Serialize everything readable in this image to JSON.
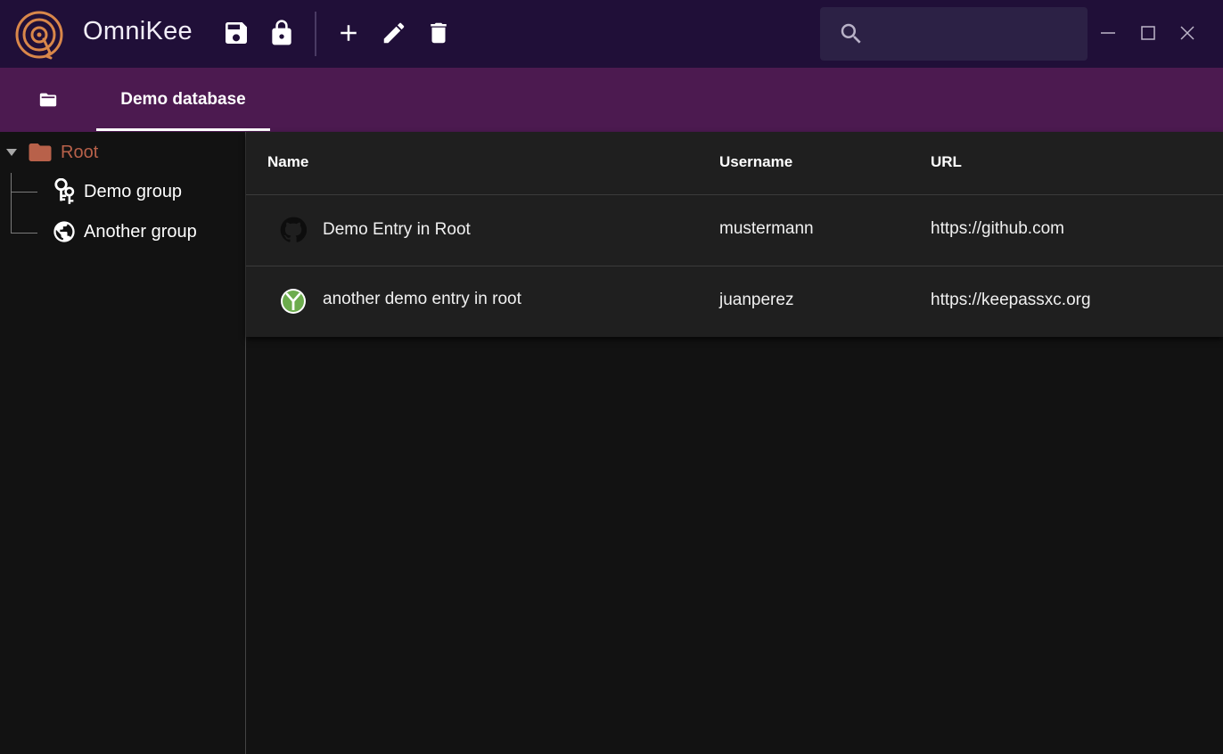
{
  "app": {
    "title": "OmniKee",
    "logo_icon": "omnikee-logo-icon",
    "accent_color": "#d9874a"
  },
  "toolbar": {
    "icons": [
      "save-icon",
      "lock-icon",
      "add-icon",
      "edit-icon",
      "delete-icon"
    ]
  },
  "search": {
    "value": "",
    "placeholder": "",
    "icon": "search-icon"
  },
  "window_controls": [
    "minimize-icon",
    "maximize-icon",
    "close-icon"
  ],
  "tabs": {
    "open_icon": "folder-open-icon",
    "items": [
      {
        "label": "Demo database",
        "active": true
      }
    ]
  },
  "tree": {
    "root": {
      "label": "Root",
      "icon": "folder-icon",
      "expanded": true,
      "color": "#b8614a"
    },
    "children": [
      {
        "label": "Demo group",
        "icon": "keys-icon"
      },
      {
        "label": "Another group",
        "icon": "globe-icon"
      }
    ]
  },
  "table": {
    "columns": [
      "Name",
      "Username",
      "URL"
    ],
    "rows": [
      {
        "name": "Demo Entry in Root",
        "username": "mustermann",
        "url": "https://github.com",
        "icon": "github-icon"
      },
      {
        "name": "another demo entry in root",
        "username": "juanperez",
        "url": "https://keepassxc.org",
        "icon": "keepassxc-icon"
      }
    ]
  },
  "colors": {
    "titlebar": "#200f38",
    "tabbar": "#4c1a50",
    "content_bg": "#121212",
    "table_bg": "#1f1f1f"
  }
}
